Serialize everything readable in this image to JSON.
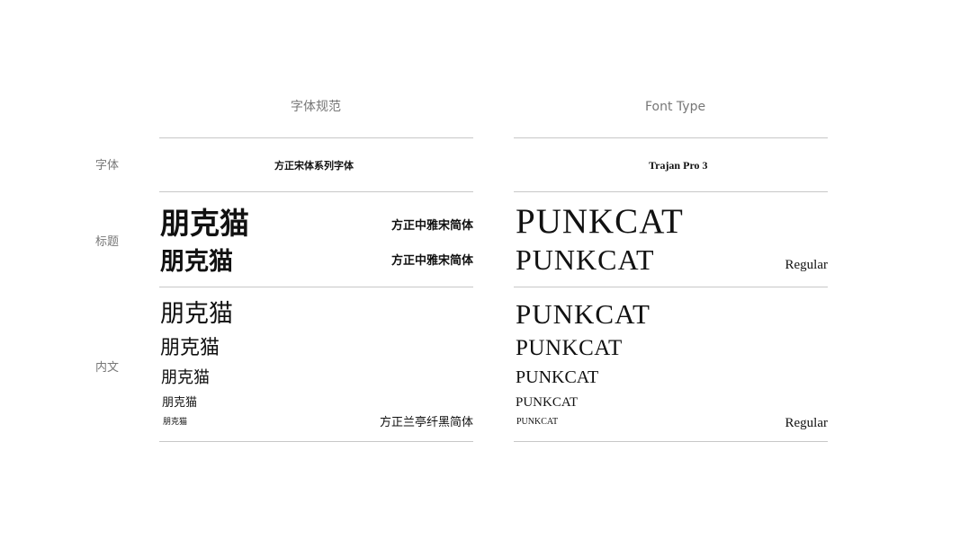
{
  "headers": {
    "cn": "字体规范",
    "en": "Font Type"
  },
  "row_labels": {
    "font": "字体",
    "title": "标题",
    "body": "内文"
  },
  "font_row": {
    "cn_family": "方正宋体系列字体",
    "en_family": "Trajan Pro 3"
  },
  "title_row": {
    "cn_sample_1": "朋克猫",
    "cn_font_1": "方正中雅宋简体",
    "cn_sample_2": "朋克猫",
    "cn_font_2": "方正中雅宋简体",
    "en_sample_1": "PUNKCAT",
    "en_sample_2": "PUNKCAT",
    "en_weight": "Regular"
  },
  "body_row": {
    "cn_samples": [
      "朋克猫",
      "朋克猫",
      "朋克猫",
      "朋克猫",
      "朋克猫"
    ],
    "cn_font": "方正兰亭纤黑简体",
    "en_samples": [
      "PUNKCAT",
      "PUNKCAT",
      "PUNKCAT",
      "PUNKCAT",
      "PUNKCAT"
    ],
    "en_weight": "Regular"
  }
}
